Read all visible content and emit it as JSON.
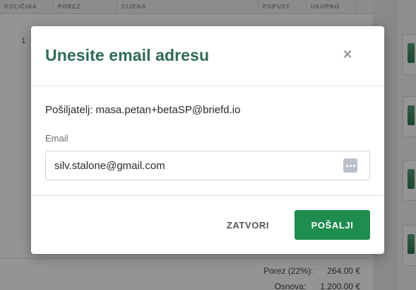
{
  "background": {
    "table_headers": [
      "KOLIČINA",
      "POREZ",
      "CIJENA",
      "POPUST",
      "UKUPNO"
    ],
    "row_number": "1",
    "summary": [
      {
        "label": "Porez (22%):",
        "value": "264.00 €"
      },
      {
        "label": "Osnova:",
        "value": "1.200.00 €"
      }
    ]
  },
  "modal": {
    "title": "Unesite email adresu",
    "close_icon": "close-x-icon",
    "sender_label": "Pošiljatelj:",
    "sender_email": "masa.petan+betaSP@briefd.io",
    "email_label": "Email",
    "email_value": "silv.stalone@gmail.com",
    "email_field_icon": "password-manager-icon",
    "cancel_label": "ZATVORI",
    "submit_label": "POŠALJI"
  },
  "colors": {
    "title": "#2f6b55",
    "primary_button": "#1f8d4f",
    "overlay": "rgba(0,0,0,0.42)"
  }
}
